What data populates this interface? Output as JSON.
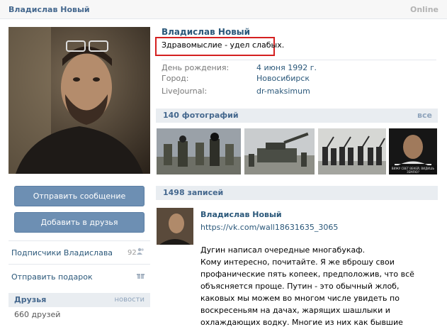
{
  "header": {
    "name": "Владислав Новый",
    "online": "Online"
  },
  "profile": {
    "name": "Владислав Новый",
    "status": "Здравомыслие - удел слабых.",
    "info": [
      {
        "label": "День рождения:",
        "value": "4 июня 1992 г."
      },
      {
        "label": "Город:",
        "value": "Новосибирск"
      },
      {
        "label": "LiveJournal:",
        "value": "dr-maksimum"
      }
    ]
  },
  "actions": {
    "send_message": "Отправить сообщение",
    "add_friend": "Добавить в друзья"
  },
  "left_links": {
    "followers": "Подписчики Владислава",
    "followers_count": "92",
    "gift": "Отправить подарок"
  },
  "friends": {
    "title": "Друзья",
    "news": "новости",
    "count": "660 друзей"
  },
  "photos": {
    "title": "140 фотографий",
    "all": "все",
    "poster_caption": "ВИЖУ СВЕТ ВЕКЕЙ, ВИДИШЬ ЗЕМЛЮ?"
  },
  "wall": {
    "title": "1498 записей",
    "post": {
      "author": "Владислав Новый",
      "link": "https://vk.com/wall18631635_3065",
      "text": "Дугин написал очередные многабукаф.\nКому интересно, почитайте. Я же вброшу свои профанические пять копеек, предположив, что всё объясняется проще. Путин - это обычный жлоб, каковых мы можем во многом числе увидеть по воскресеньям на дачах, жарящих шашлыки и охлаждающих водку. Многие из них как бывшие военные, бывшие спортсмены. Неплохие люди -"
    }
  },
  "colors": {
    "link": "#2b587a",
    "section_bg": "#e9edf1",
    "button": "#6d8fb3",
    "status_frame": "#d42020"
  }
}
